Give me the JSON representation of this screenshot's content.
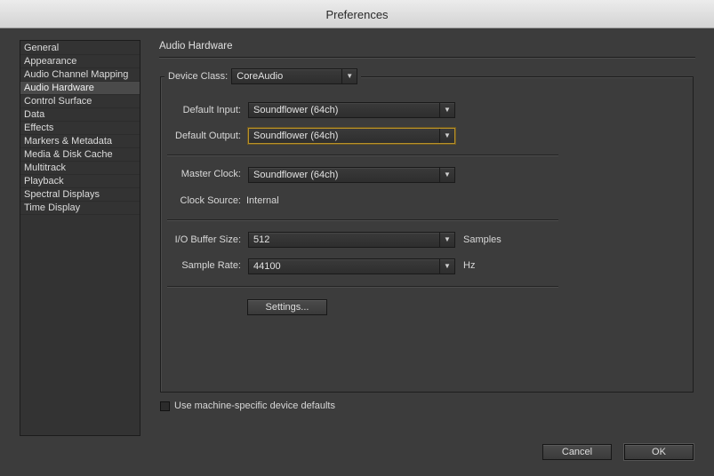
{
  "window": {
    "title": "Preferences"
  },
  "sidebar": {
    "items": [
      {
        "label": "General"
      },
      {
        "label": "Appearance"
      },
      {
        "label": "Audio Channel Mapping"
      },
      {
        "label": "Audio Hardware",
        "selected": true
      },
      {
        "label": "Control Surface"
      },
      {
        "label": "Data"
      },
      {
        "label": "Effects"
      },
      {
        "label": "Markers & Metadata"
      },
      {
        "label": "Media & Disk Cache"
      },
      {
        "label": "Multitrack"
      },
      {
        "label": "Playback"
      },
      {
        "label": "Spectral Displays"
      },
      {
        "label": "Time Display"
      }
    ]
  },
  "main": {
    "section_title": "Audio Hardware",
    "device_class": {
      "label": "Device Class:",
      "value": "CoreAudio"
    },
    "default_input": {
      "label": "Default Input:",
      "value": "Soundflower (64ch)"
    },
    "default_output": {
      "label": "Default Output:",
      "value": "Soundflower (64ch)"
    },
    "master_clock": {
      "label": "Master Clock:",
      "value": "Soundflower (64ch)"
    },
    "clock_source": {
      "label": "Clock Source:",
      "value": "Internal"
    },
    "io_buffer": {
      "label": "I/O Buffer Size:",
      "value": "512",
      "unit": "Samples"
    },
    "sample_rate": {
      "label": "Sample Rate:",
      "value": "44100",
      "unit": "Hz"
    },
    "settings_button": "Settings...",
    "machine_defaults": {
      "label": "Use machine-specific device defaults",
      "checked": false
    }
  },
  "footer": {
    "cancel": "Cancel",
    "ok": "OK"
  },
  "icons": {
    "dropdown": "chevron-down-icon"
  },
  "colors": {
    "focus": "#b8922a",
    "background": "#3c3c3c"
  }
}
